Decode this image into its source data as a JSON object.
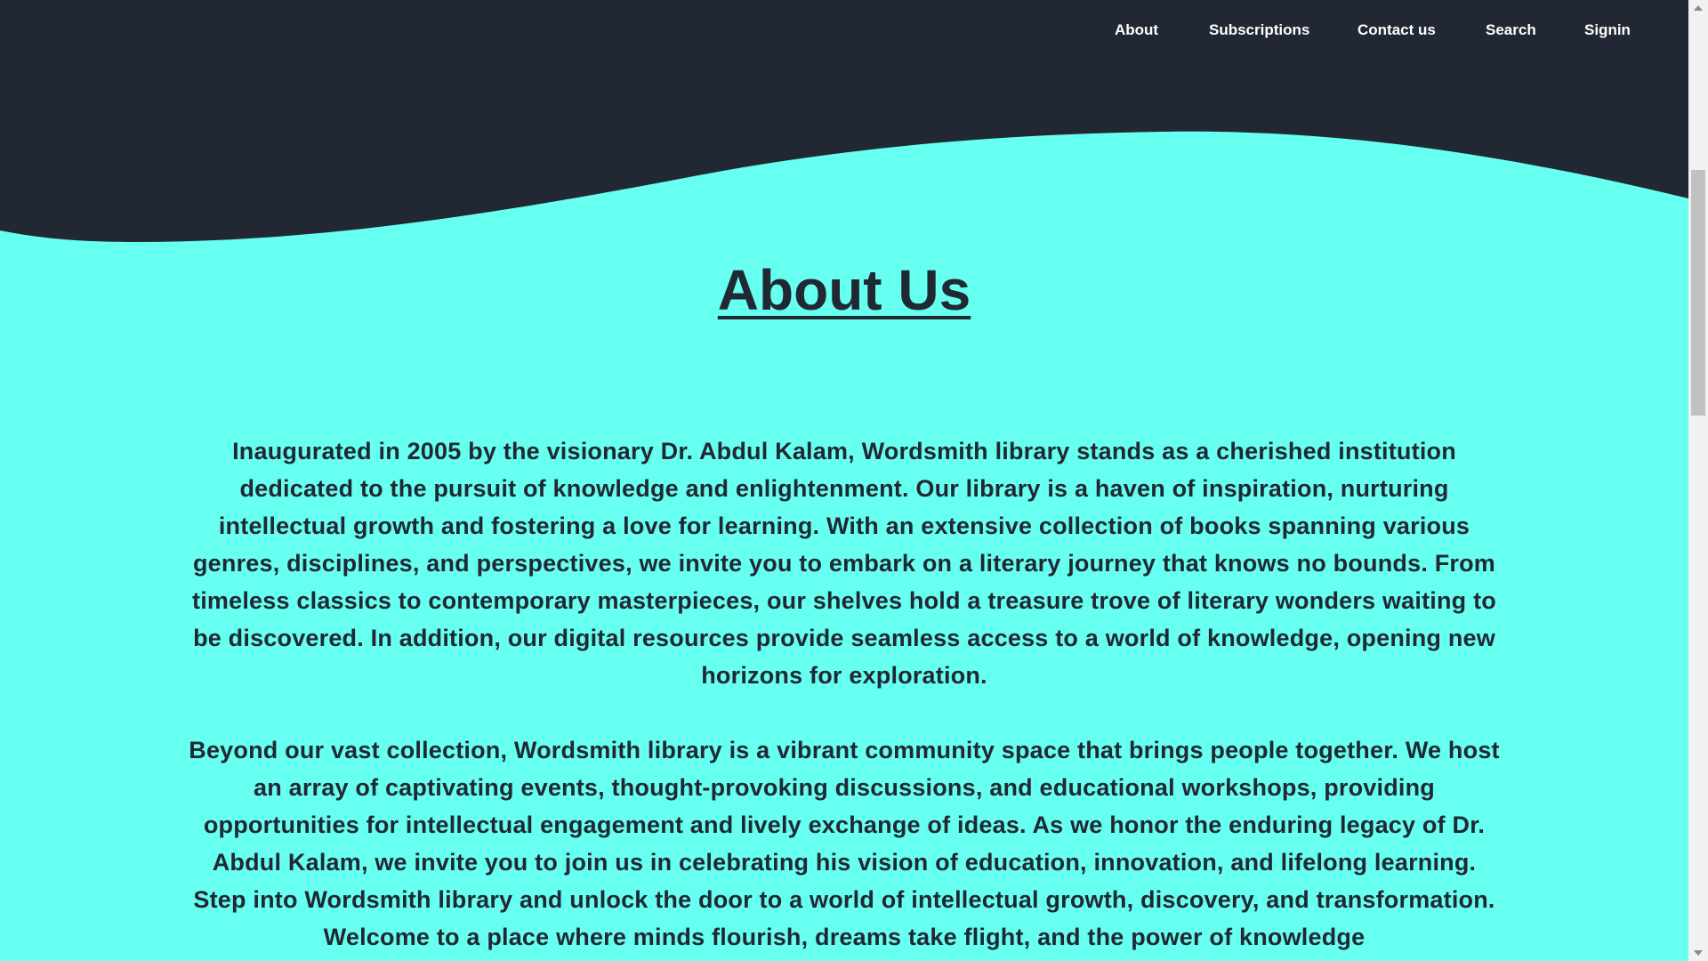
{
  "nav": {
    "items": [
      {
        "label": "About"
      },
      {
        "label": "Subscriptions"
      },
      {
        "label": "Contact us"
      },
      {
        "label": "Search"
      },
      {
        "label": "Signin"
      }
    ]
  },
  "main": {
    "title": "About Us",
    "paragraphs": [
      "Inaugurated in 2005 by the visionary Dr. Abdul Kalam, Wordsmith library stands as a cherished institution dedicated to the pursuit of knowledge and enlightenment. Our library is a haven of inspiration, nurturing intellectual growth and fostering a love for learning. With an extensive collection of books spanning various genres, disciplines, and perspectives, we invite you to embark on a literary journey that knows no bounds. From timeless classics to contemporary masterpieces, our shelves hold a treasure trove of literary wonders waiting to be discovered. In addition, our digital resources provide seamless access to a world of knowledge, opening new horizons for exploration.",
      "Beyond our vast collection, Wordsmith library is a vibrant community space that brings people together. We host an array of captivating events, thought-provoking discussions, and educational workshops, providing opportunities for intellectual engagement and lively exchange of ideas. As we honor the enduring legacy of Dr. Abdul Kalam, we invite you to join us in celebrating his vision of education, innovation, and lifelong learning. Step into Wordsmith library and unlock the door to a world of intellectual growth, discovery, and transformation. Welcome to a place where minds flourish, dreams take flight, and the power of knowledge"
    ]
  },
  "colors": {
    "header_dark": "#222833",
    "background_cyan": "#66FFF0",
    "text_dark": "#1F2833",
    "nav_text": "#FFFFFF"
  },
  "icons": {
    "scroll_up": "scroll-up-arrow-icon",
    "scroll_down": "scroll-down-arrow-icon"
  }
}
